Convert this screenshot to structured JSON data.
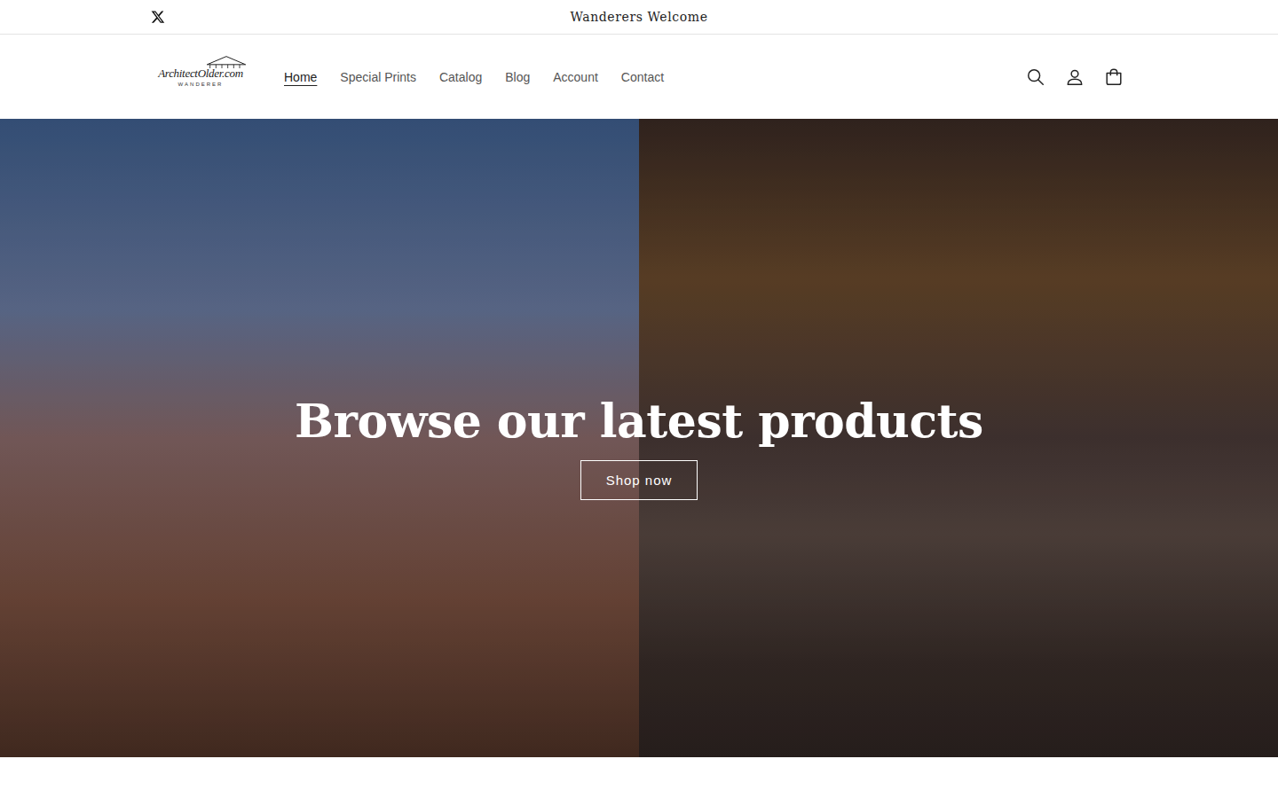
{
  "announcement": {
    "text": "Wanderers Welcome"
  },
  "logo": {
    "name": "ArchitectOlder.com",
    "tagline": "WANDERER"
  },
  "nav": [
    {
      "label": "Home",
      "selected": true
    },
    {
      "label": "Special Prints",
      "selected": false
    },
    {
      "label": "Catalog",
      "selected": false
    },
    {
      "label": "Blog",
      "selected": false
    },
    {
      "label": "Account",
      "selected": false
    },
    {
      "label": "Contact",
      "selected": false
    }
  ],
  "hero": {
    "heading": "Browse our latest products",
    "button": "Shop now"
  }
}
